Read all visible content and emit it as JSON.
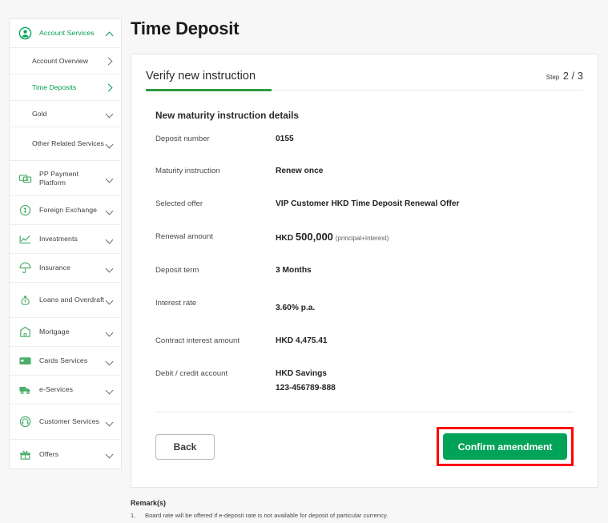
{
  "colors": {
    "brand_green": "#00a357",
    "accent_green": "#2d9b3f",
    "highlight_red": "#ff0000",
    "page_bg": "#f7f7f7"
  },
  "sidebar": {
    "groups": [
      {
        "label": "Account Services",
        "icon": "person-circle-icon",
        "expanded": true,
        "active": true,
        "chevron": "chevron-up-icon",
        "children": [
          {
            "label": "Account Overview",
            "chevron": "chevron-right-icon",
            "active": false
          },
          {
            "label": "Time Deposits",
            "chevron": "chevron-right-icon",
            "active": true
          },
          {
            "label": "Gold",
            "chevron": "chevron-down-icon",
            "active": false
          },
          {
            "label": "Other Related Services",
            "chevron": "chevron-down-icon",
            "active": false
          }
        ]
      },
      {
        "label": "PP Payment Platform",
        "icon": "banknotes-icon",
        "chevron": "chevron-down-icon",
        "active": false
      },
      {
        "label": "Foreign Exchange",
        "icon": "currency-exchange-icon",
        "chevron": "chevron-down-icon",
        "active": false
      },
      {
        "label": "Investments",
        "icon": "line-chart-icon",
        "chevron": "chevron-down-icon",
        "active": false
      },
      {
        "label": "Insurance",
        "icon": "umbrella-icon",
        "chevron": "chevron-down-icon",
        "active": false
      },
      {
        "label": "Loans and Overdraft",
        "icon": "money-bag-icon",
        "chevron": "chevron-down-icon",
        "active": false
      },
      {
        "label": "Mortgage",
        "icon": "house-icon",
        "chevron": "chevron-down-icon",
        "active": false
      },
      {
        "label": "Cards Services",
        "icon": "credit-card-icon",
        "chevron": "chevron-down-icon",
        "active": false
      },
      {
        "label": "e-Services",
        "icon": "delivery-van-icon",
        "chevron": "chevron-down-icon",
        "active": false
      },
      {
        "label": "Customer Services",
        "icon": "headset-icon",
        "chevron": "chevron-down-icon",
        "active": false
      },
      {
        "label": "Offers",
        "icon": "gift-icon",
        "chevron": "chevron-down-icon",
        "active": false
      }
    ]
  },
  "page": {
    "title": "Time Deposit"
  },
  "card": {
    "tab_title": "Verify new instruction",
    "step_word": "Step",
    "step_value": "2 / 3",
    "section_title": "New maturity instruction details",
    "rows": [
      {
        "label": "Deposit number",
        "value": "0155"
      },
      {
        "label": "Maturity instruction",
        "value": "Renew once"
      },
      {
        "label": "Selected offer",
        "value": "VIP Customer HKD Time Deposit Renewal Offer"
      },
      {
        "label": "Renewal amount",
        "currency": "HKD",
        "amount": "500,000",
        "note": "(principal+Interest)"
      },
      {
        "label": "Deposit term",
        "value": "3 Months"
      },
      {
        "label": "Interest rate",
        "value": "3.60% p.a."
      },
      {
        "label": "Contract interest amount",
        "value": "HKD 4,475.41"
      },
      {
        "label": "Debit / credit account",
        "value": "HKD Savings",
        "value_line2": "123-456789-888"
      }
    ],
    "back_label": "Back",
    "confirm_label": "Confirm amendment"
  },
  "remarks": {
    "title": "Remark(s)",
    "items": [
      {
        "num": "1.",
        "text": "Board rate will be offered if e-deposit rate is not available for deposit of particular currency."
      }
    ]
  }
}
